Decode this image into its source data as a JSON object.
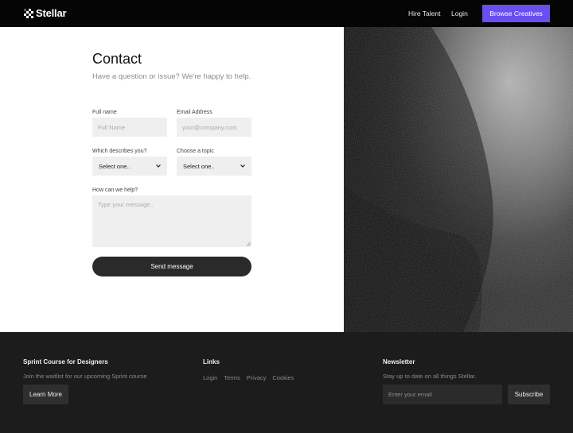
{
  "nav": {
    "logo_text": "Stellar",
    "logo_icon": "checker-logo-icon",
    "links": [
      "Hire Talent",
      "Login"
    ],
    "cta_label": "Browse Creatives",
    "cta_color": "#6b4ef0"
  },
  "contact": {
    "title": "Contact",
    "subtitle": "Have a question or issue? We're happy to help.",
    "full_name": {
      "label": "Full name",
      "placeholder": "Full Name",
      "value": ""
    },
    "email": {
      "label": "Email Address",
      "placeholder": "your@company.com",
      "value": ""
    },
    "describes": {
      "label": "Which describes you?",
      "selected": "Select one.."
    },
    "topic": {
      "label": "Choose a topic",
      "selected": "Select one.."
    },
    "help": {
      "label": "How can we help?",
      "placeholder": "Type your message..",
      "value": ""
    },
    "send_label": "Send message"
  },
  "footer": {
    "course": {
      "heading": "Sprint Course for Designers",
      "text": "Join the waitlist for our upcoming Sprint course",
      "button": "Learn More"
    },
    "links": {
      "heading": "Links",
      "items": [
        "Login",
        "Terms",
        "Privacy",
        "Cookies"
      ]
    },
    "newsletter": {
      "heading": "Newsletter",
      "text": "Stay up to date on all things Stellar.",
      "placeholder": "Enter your email",
      "button": "Subscribe"
    }
  }
}
